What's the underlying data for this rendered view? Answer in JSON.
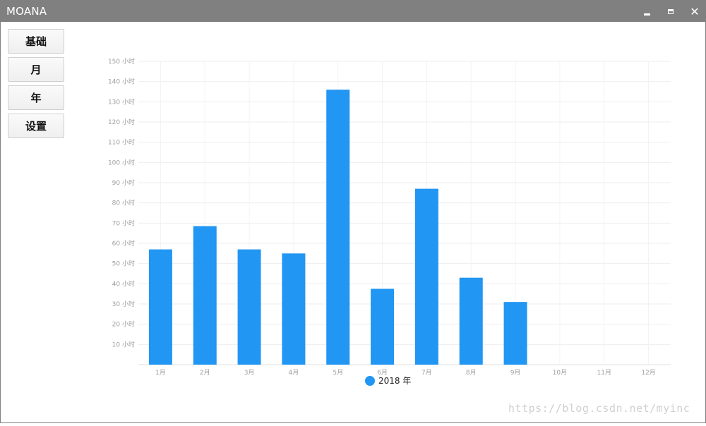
{
  "window": {
    "title": "MOANA",
    "minimize_icon": "minimize-icon",
    "maximize_icon": "maximize-icon",
    "close_icon": "close-icon",
    "close_glyph": "✕"
  },
  "nav": {
    "items": [
      {
        "label": "基础"
      },
      {
        "label": "月"
      },
      {
        "label": "年"
      },
      {
        "label": "设置"
      }
    ]
  },
  "chart_data": {
    "type": "bar",
    "categories": [
      "1月",
      "2月",
      "3月",
      "4月",
      "5月",
      "6月",
      "7月",
      "8月",
      "9月",
      "10月",
      "11月",
      "12月"
    ],
    "series": [
      {
        "name": "2018 年",
        "values": [
          57,
          68.5,
          57,
          55,
          136,
          37.5,
          87,
          43,
          31,
          0,
          0,
          0
        ],
        "color": "#2196F3"
      }
    ],
    "ylim": [
      0,
      150
    ],
    "y_ticks": [
      10,
      20,
      30,
      40,
      50,
      60,
      70,
      80,
      90,
      100,
      110,
      120,
      130,
      140,
      150
    ],
    "y_tick_suffix": " 小时",
    "grid": true,
    "legend": "bottom-center"
  },
  "watermark": "https://blog.csdn.net/myinc"
}
